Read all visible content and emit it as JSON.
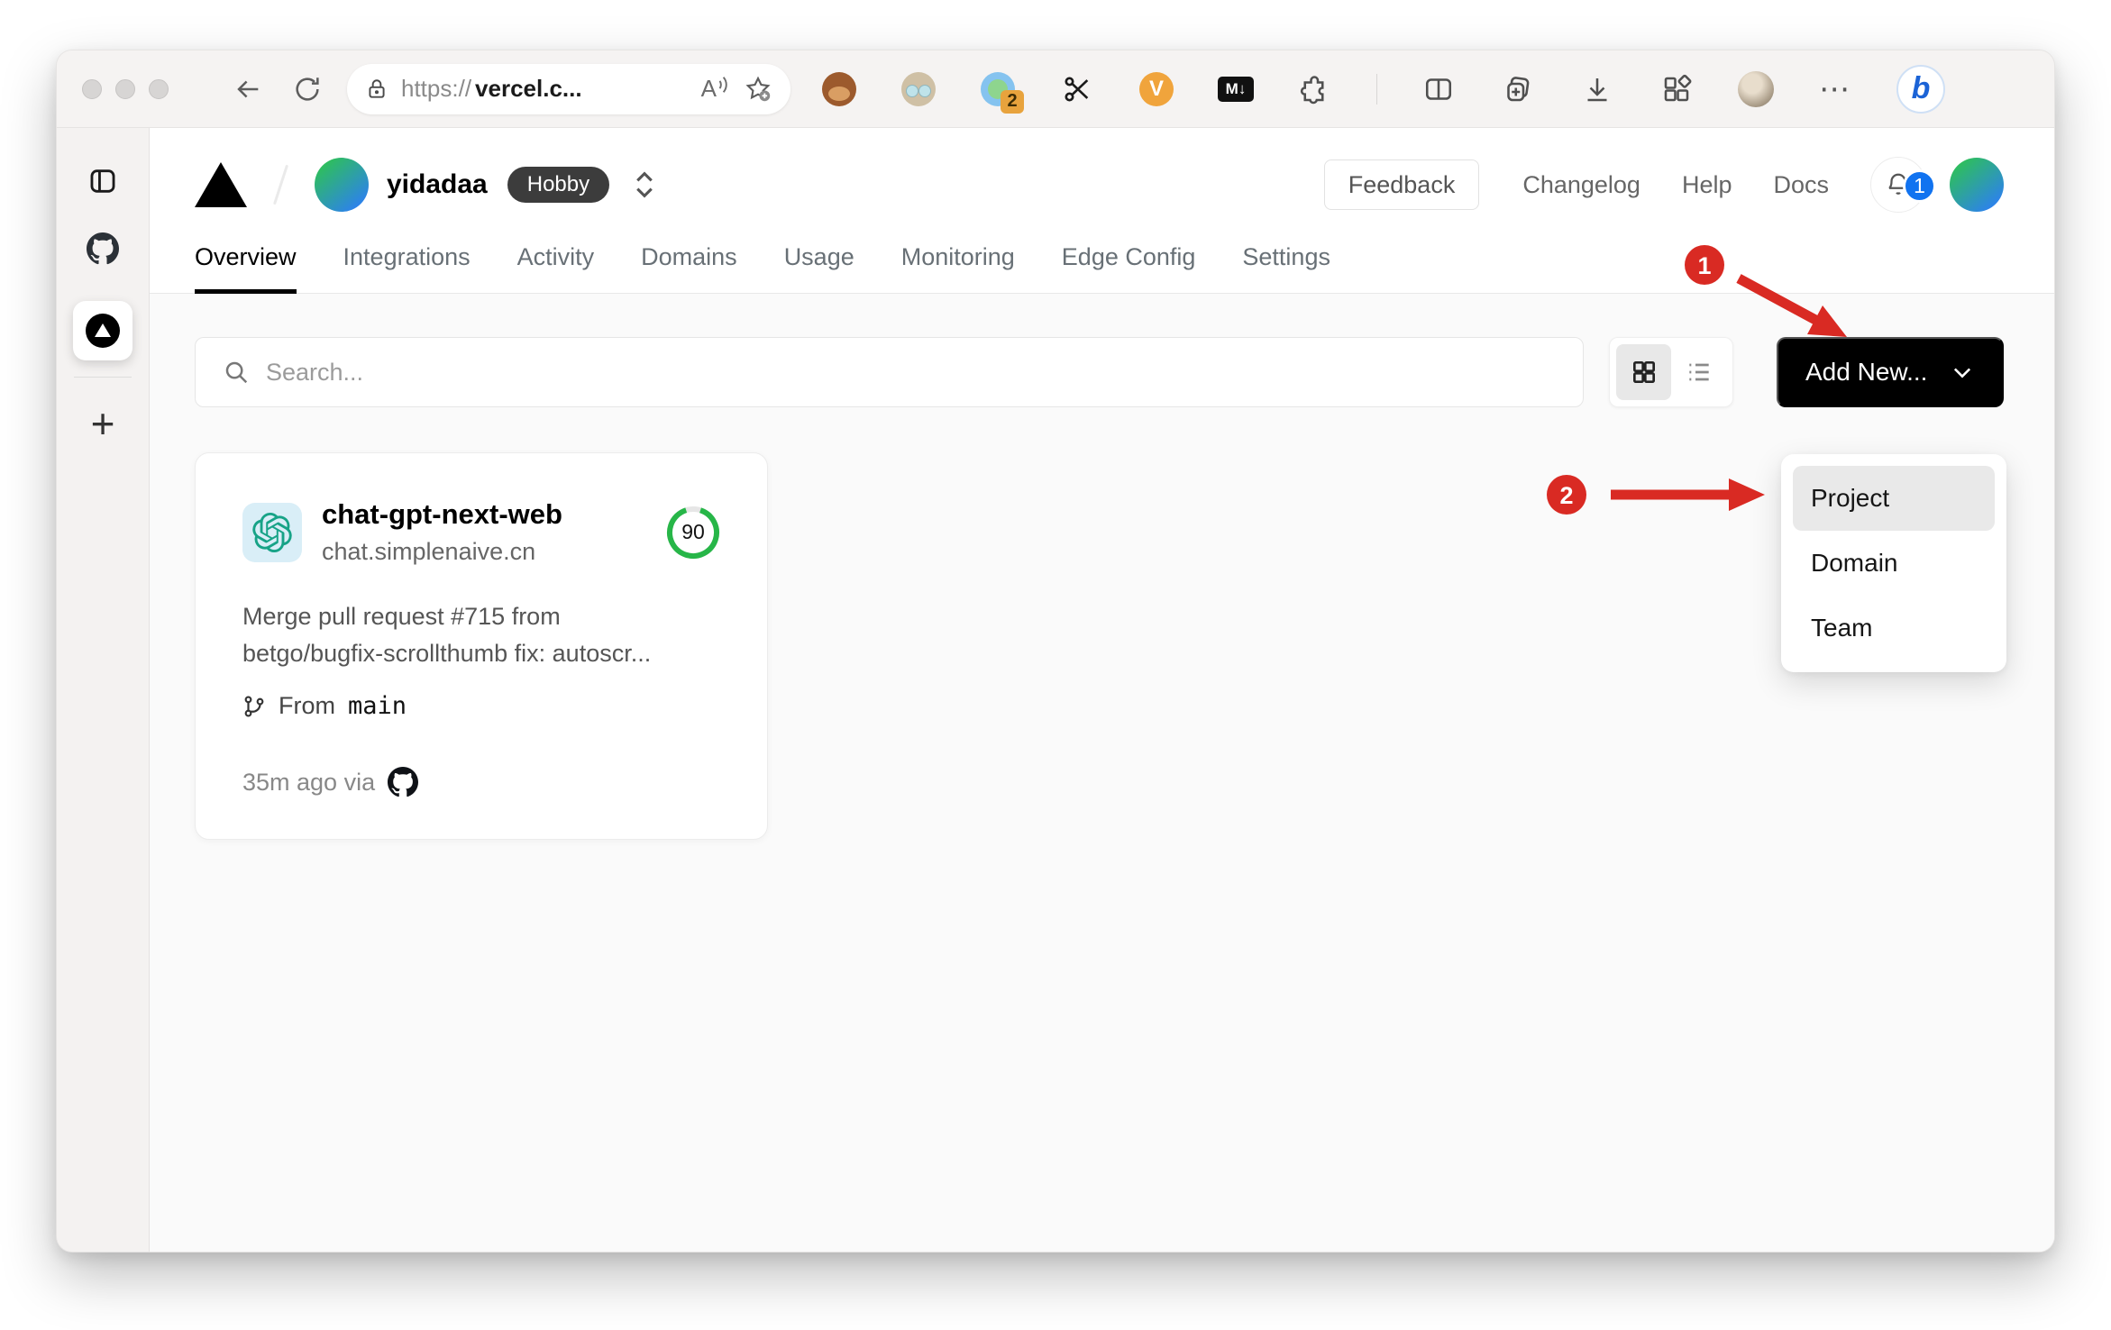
{
  "browser": {
    "url_scheme": "https://",
    "url_host": "vercel.c...",
    "read_aloud_glyph": "A",
    "extensions_badge": "2",
    "v_ext_glyph": "V",
    "markdown_ext_glyph": "M↓",
    "ellipsis_glyph": "⋯",
    "bing_glyph": "b",
    "sidebar_plus_glyph": "+"
  },
  "header": {
    "team_name": "yidadaa",
    "plan_badge": "Hobby",
    "feedback_label": "Feedback",
    "links": [
      "Changelog",
      "Help",
      "Docs"
    ],
    "notification_count": "1"
  },
  "tabs": {
    "active": "Overview",
    "items": [
      "Overview",
      "Integrations",
      "Activity",
      "Domains",
      "Usage",
      "Monitoring",
      "Edge Config",
      "Settings"
    ]
  },
  "controls": {
    "search_placeholder": "Search...",
    "add_new_label": "Add New..."
  },
  "dropdown": {
    "highlighted": "Project",
    "items": [
      "Project",
      "Domain",
      "Team"
    ]
  },
  "project_card": {
    "name": "chat-gpt-next-web",
    "domain": "chat.simplenaive.cn",
    "score": "90",
    "commit_line1": "Merge pull request #715 from",
    "commit_line2": "betgo/bugfix-scrollthumb fix: autoscr...",
    "branch_prefix": "From",
    "branch_name": "main",
    "deploy_meta": "35m ago via"
  },
  "annotations": {
    "step1": "1",
    "step2": "2"
  },
  "colors": {
    "annotation_red": "#d92a23",
    "score_green": "#27b648",
    "notification_blue": "#1173f0",
    "add_new_bg": "#000000",
    "openai_teal": "#17a387"
  }
}
